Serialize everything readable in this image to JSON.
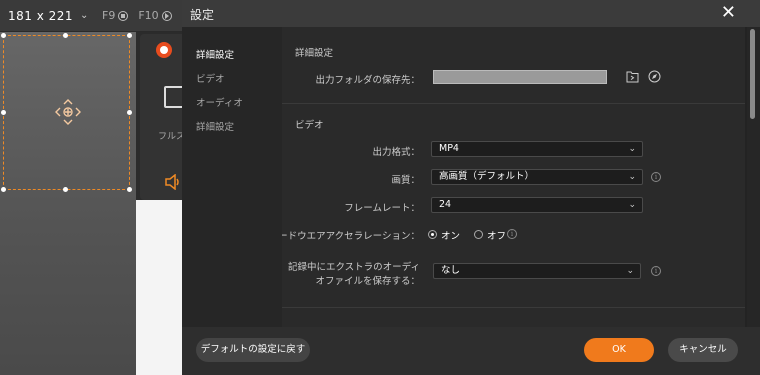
{
  "recorder": {
    "size_readout": "181 x 221",
    "hotkey_stop": "F9",
    "hotkey_pause": "F10",
    "fullscreen_label": "フルス"
  },
  "dialog": {
    "title": "設定",
    "nav": [
      "詳細設定",
      "ビデオ",
      "オーディオ",
      "詳細設定"
    ],
    "advanced": {
      "section_title": "詳細設定",
      "output_folder_label": "出力フォルダの保存先："
    },
    "video": {
      "section_title": "ビデオ",
      "format_label": "出力格式：",
      "format_value": "MP4",
      "quality_label": "画質：",
      "quality_value": "高画質（デフォルト）",
      "framerate_label": "フレームレート：",
      "framerate_value": "24",
      "gpu_label": "GPUハードウエアアクセラレーション：",
      "gpu_on": "オン",
      "gpu_off": "オフ",
      "extra_audio_label": "記録中にエクストラのオーディオファイルを保存する：",
      "extra_audio_value": "なし"
    },
    "footer": {
      "default_button": "デフォルトの設定に戻す",
      "ok_button": "OK",
      "cancel_button": "キャンセル"
    }
  },
  "colors": {
    "accent": "#f07a1c",
    "dialog_bg": "#2a2a2a",
    "region_border": "#f08a24"
  }
}
